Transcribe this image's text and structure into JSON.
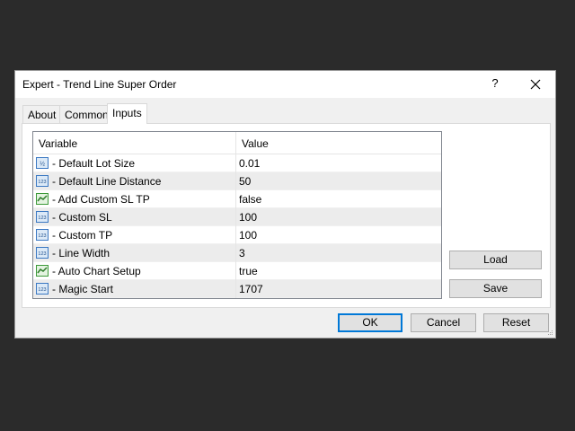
{
  "window": {
    "title": "Expert - Trend Line Super Order",
    "help_label": "?"
  },
  "tabs": [
    {
      "label": "About",
      "active": false
    },
    {
      "label": "Common",
      "active": false
    },
    {
      "label": "Inputs",
      "active": true
    }
  ],
  "grid": {
    "columns": [
      "Variable",
      "Value"
    ],
    "rows": [
      {
        "icon": "double-value-icon",
        "variable": "- Default Lot Size",
        "value": "0.01"
      },
      {
        "icon": "integer-value-icon",
        "variable": "- Default Line Distance",
        "value": "50"
      },
      {
        "icon": "boolean-value-icon",
        "variable": "- Add Custom SL TP",
        "value": "false"
      },
      {
        "icon": "integer-value-icon",
        "variable": "- Custom SL",
        "value": "100"
      },
      {
        "icon": "integer-value-icon",
        "variable": "- Custom TP",
        "value": "100"
      },
      {
        "icon": "integer-value-icon",
        "variable": "- Line Width",
        "value": "3"
      },
      {
        "icon": "boolean-value-icon",
        "variable": "- Auto Chart Setup",
        "value": "true"
      },
      {
        "icon": "integer-value-icon",
        "variable": "- Magic Start",
        "value": "1707"
      }
    ]
  },
  "side_buttons": {
    "load": "Load",
    "save": "Save"
  },
  "footer_buttons": {
    "ok": "OK",
    "cancel": "Cancel",
    "reset": "Reset"
  },
  "colors": {
    "selected_border": "#0078d7",
    "row_alt": "#ececec"
  }
}
